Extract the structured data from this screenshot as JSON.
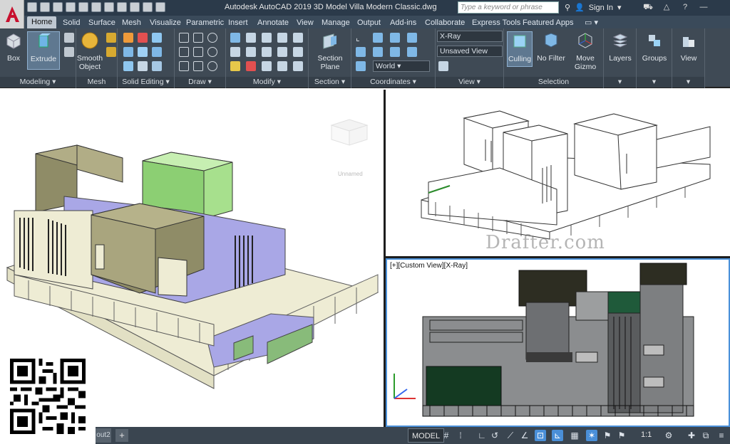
{
  "titlebar": {
    "title": "Autodesk AutoCAD 2019   3D Model Villa Modern Classic.dwg",
    "search_placeholder": "Type a keyword or phrase",
    "sign_in": "Sign In"
  },
  "tabs": [
    "Home",
    "Solid",
    "Surface",
    "Mesh",
    "Visualize",
    "Parametric",
    "Insert",
    "Annotate",
    "View",
    "Manage",
    "Output",
    "Add-ins",
    "Collaborate",
    "Express Tools",
    "Featured Apps"
  ],
  "ribbon": {
    "modeling": {
      "title": "Modeling",
      "box": "Box",
      "extrude": "Extrude",
      "smooth_object": "Smooth Object"
    },
    "mesh": {
      "title": "Mesh"
    },
    "solid_editing": {
      "title": "Solid Editing"
    },
    "draw": {
      "title": "Draw"
    },
    "modify": {
      "title": "Modify"
    },
    "section": {
      "title": "Section",
      "section_plane": "Section Plane"
    },
    "coordinates": {
      "title": "Coordinates",
      "ucs": "World"
    },
    "view": {
      "title": "View",
      "visual_style": "X-Ray",
      "view_name": "Unsaved View"
    },
    "selection": {
      "title": "Selection",
      "culling": "Culling",
      "no_filter": "No Filter",
      "move_gizmo": "Move Gizmo"
    },
    "layers": {
      "label": "Layers"
    },
    "groups": {
      "label": "Groups"
    },
    "view_big": {
      "label": "View"
    }
  },
  "viewports": {
    "bottom_right_label": "[+][Custom View][X-Ray]",
    "watermark": "Drafter.com",
    "viewcube_label": "Unnamed"
  },
  "statusbar": {
    "layout_tab": "out2",
    "add_tab": "+",
    "model": "MODEL",
    "scale": "1:1"
  },
  "colors": {
    "ribbon_bg": "#3f4a55",
    "titlebar_bg": "#2b3a4a",
    "accent": "#4a90d9",
    "wall_lavender": "#a9a7e6",
    "wall_cream": "#eeecd4",
    "olive": "#8f8c67",
    "green_box": "#a7e08d"
  }
}
